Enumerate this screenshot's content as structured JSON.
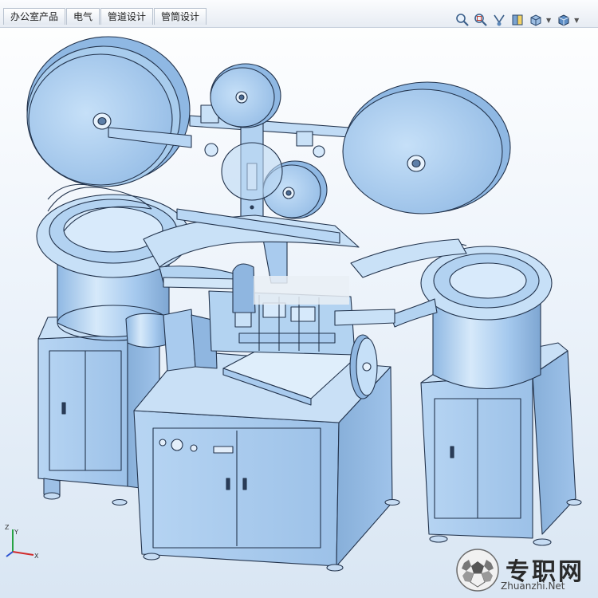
{
  "toolbar": {
    "tabs": [
      {
        "label": "办公室产品"
      },
      {
        "label": "电气"
      },
      {
        "label": "管道设计"
      },
      {
        "label": "管筒设计"
      }
    ],
    "view_tools": [
      {
        "icon": "zoom-to-fit-icon"
      },
      {
        "icon": "zoom-area-icon"
      },
      {
        "icon": "previous-view-icon"
      },
      {
        "icon": "section-view-icon"
      },
      {
        "icon": "view-orientation-icon"
      },
      {
        "icon": "display-style-icon"
      }
    ]
  },
  "triad": {
    "x": "X",
    "y": "Y",
    "z": "Z"
  },
  "watermark": {
    "chinese": "专职网",
    "english": "Zhuanzhi.Net"
  },
  "colors": {
    "part_fill": "#a9cdef",
    "part_fill_light": "#d2e6f8",
    "part_fill_dark": "#7fa9d4",
    "edge": "#23344d"
  }
}
